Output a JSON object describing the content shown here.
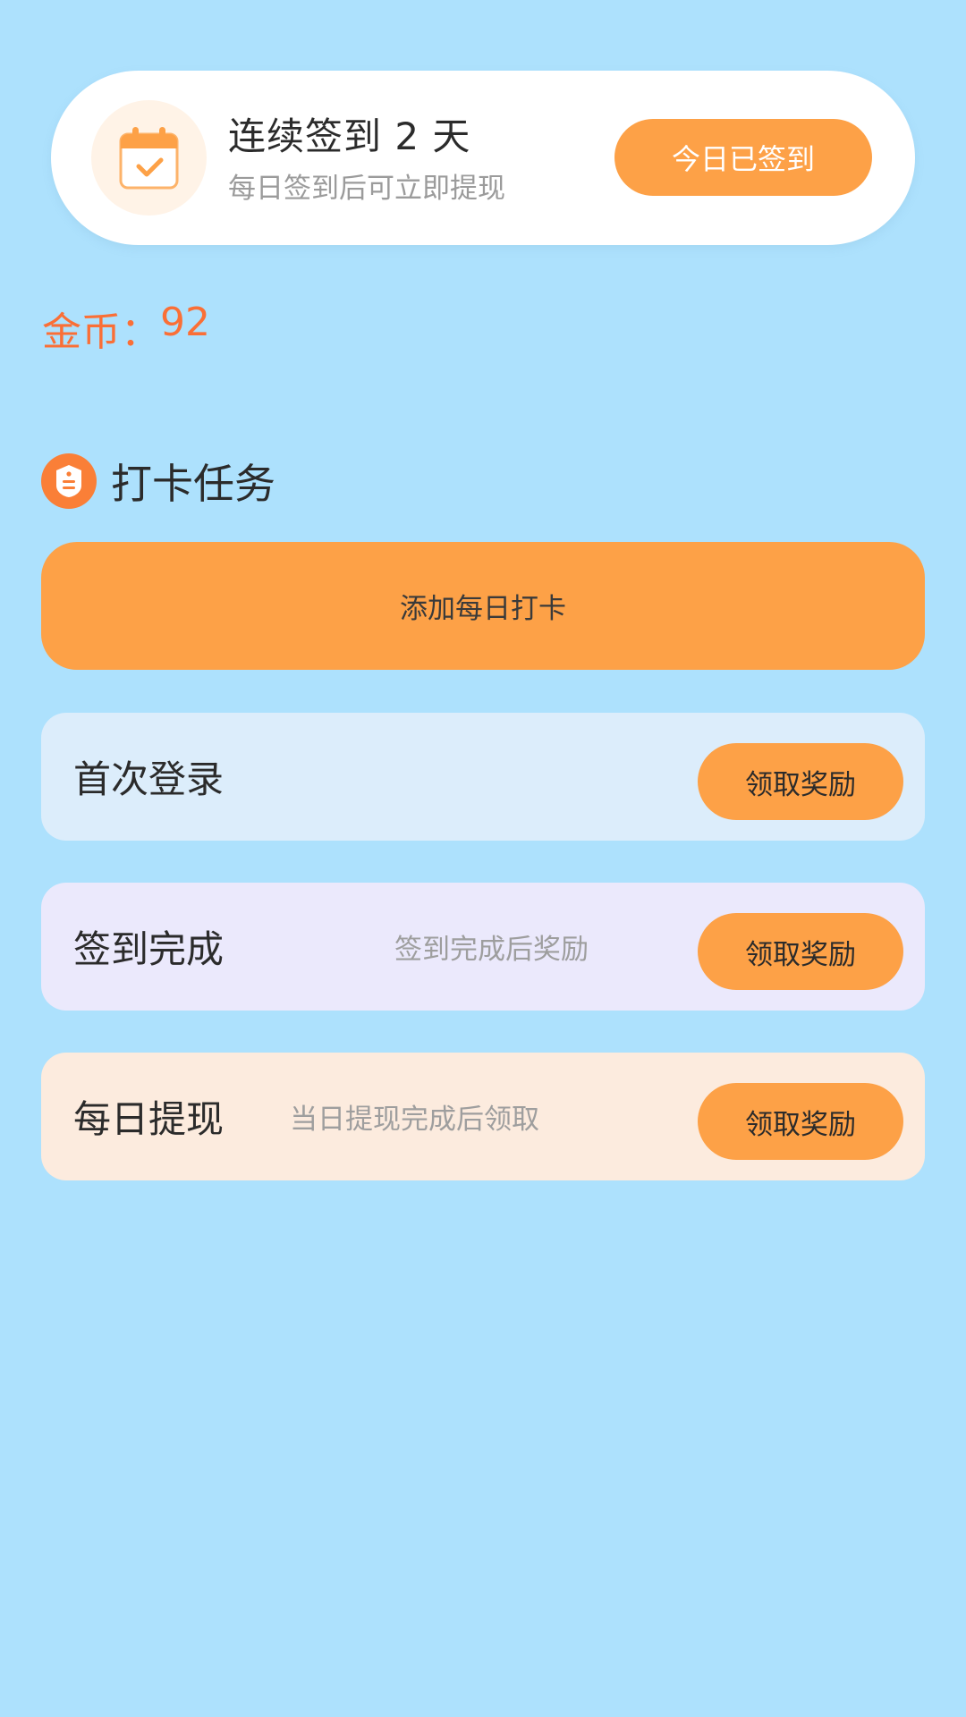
{
  "checkin": {
    "title": "连续签到 2 天",
    "subtitle": "每日签到后可立即提现",
    "button_label": "今日已签到",
    "icon": "calendar-check-icon"
  },
  "coins": {
    "label": "金币：",
    "value": "92"
  },
  "tasks_section": {
    "title": "打卡任务",
    "icon": "task-badge-icon",
    "add_button_label": "添加每日打卡",
    "items": [
      {
        "name": "首次登录",
        "description": "",
        "button_label": "领取奖励"
      },
      {
        "name": "签到完成",
        "description": "签到完成后奖励",
        "button_label": "领取奖励"
      },
      {
        "name": "每日提现",
        "description": "当日提现完成后领取",
        "button_label": "领取奖励"
      }
    ]
  },
  "colors": {
    "background": "#ade1fd",
    "accent": "#fda147",
    "coin_text": "#fa6f36",
    "row1_bg": "#dcedfb",
    "row2_bg": "#ebe9fc",
    "row3_bg": "#fcebde"
  }
}
